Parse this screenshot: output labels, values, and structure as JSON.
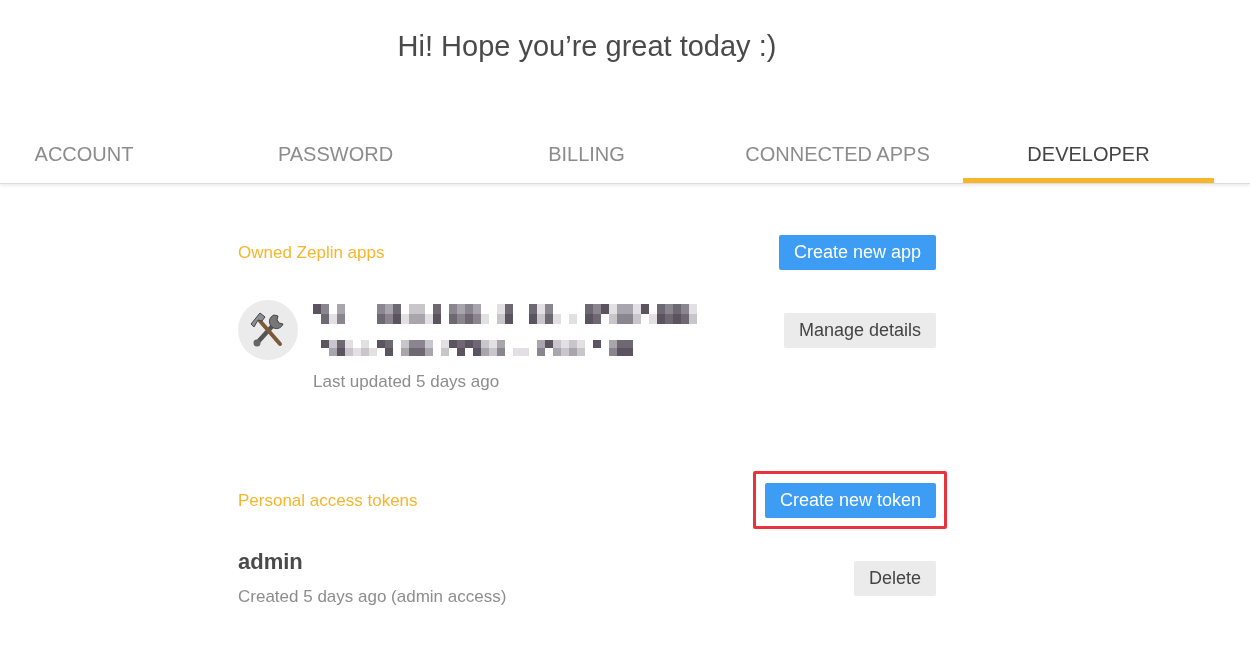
{
  "greeting": "Hi! Hope you’re great today :)",
  "tabs": [
    {
      "label": "ACCOUNT",
      "selected": false
    },
    {
      "label": "PASSWORD",
      "selected": false
    },
    {
      "label": "BILLING",
      "selected": false
    },
    {
      "label": "CONNECTED APPS",
      "selected": false
    },
    {
      "label": "DEVELOPER",
      "selected": true
    }
  ],
  "sections": [
    {
      "kind": "apps",
      "title": "Owned Zeplin apps",
      "action": {
        "label": "Create new app",
        "highlighted": false
      },
      "items": [
        {
          "redacted": true,
          "meta": "Last updated 5 days ago",
          "action": "Manage details"
        }
      ]
    },
    {
      "kind": "tokens",
      "title": "Personal access tokens",
      "action": {
        "label": "Create new token",
        "highlighted": true
      },
      "items": [
        {
          "redacted": false,
          "name": "admin",
          "meta": "Created 5 days ago (admin access)",
          "action": "Delete"
        }
      ]
    }
  ]
}
